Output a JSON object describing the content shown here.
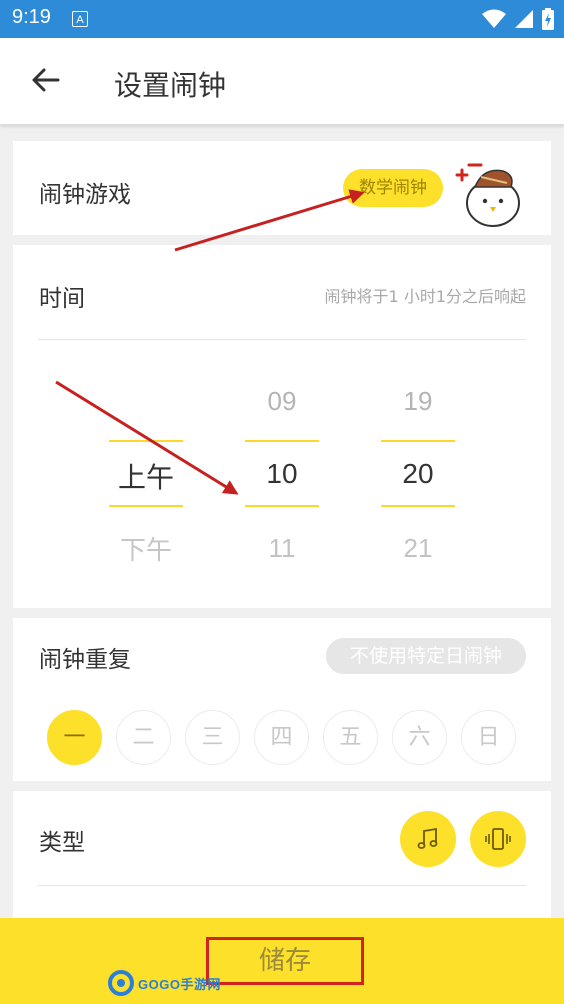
{
  "status_bar": {
    "time": "9:19",
    "notification_icon_label": "A",
    "bg_color": "#2e8bd8"
  },
  "app_bar": {
    "back_icon": "arrow-left-icon",
    "title": "设置闹钟"
  },
  "alarm_game": {
    "label": "闹钟游戏",
    "selected_game": "数学闹钟",
    "mascot_icon": "chick-mascot-icon"
  },
  "time": {
    "label": "时间",
    "hint": "闹钟将于1 小时1分之后响起",
    "ampm_column": {
      "prev": "",
      "selected": "上午",
      "next": "下午"
    },
    "hour_column": {
      "prev": "09",
      "selected": "10",
      "next": "11"
    },
    "minute_column": {
      "prev": "19",
      "selected": "20",
      "next": "21"
    }
  },
  "repeat": {
    "label": "闹钟重复",
    "mode_pill": "不使用特定日闹钟",
    "days": [
      {
        "label": "一",
        "active": true
      },
      {
        "label": "二",
        "active": false
      },
      {
        "label": "三",
        "active": false
      },
      {
        "label": "四",
        "active": false
      },
      {
        "label": "五",
        "active": false
      },
      {
        "label": "六",
        "active": false
      },
      {
        "label": "日",
        "active": false
      }
    ]
  },
  "type": {
    "label": "类型",
    "options": [
      "music-note-icon",
      "phone-vibrate-icon"
    ]
  },
  "footer": {
    "save_label": "储存",
    "watermark_text": "GOGO手游网"
  },
  "colors": {
    "accent_yellow": "#fde02a",
    "annotation_red": "#d0251e"
  }
}
